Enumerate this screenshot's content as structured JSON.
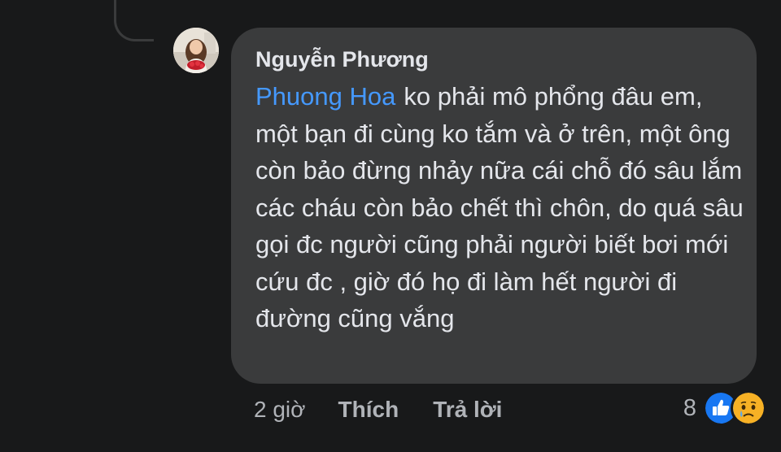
{
  "comment": {
    "author": "Nguyễn Phương",
    "mention": "Phuong Hoa",
    "text": "ko phải mô phổng đâu em, một bạn đi cùng ko tắm và ở trên, một ông còn bảo đừng nhảy nữa cái chỗ đó sâu lắm các cháu còn bảo chết thì chôn, do quá sâu gọi đc người cũng phải người biết bơi mới cứu đc , giờ đó họ đi làm hết người đi đường cũng vắng"
  },
  "actions": {
    "time": "2 giờ",
    "like_label": "Thích",
    "reply_label": "Trả lời"
  },
  "reactions": {
    "count": "8",
    "icons": [
      "like-reaction-icon",
      "sad-reaction-icon"
    ]
  },
  "colors": {
    "background": "#18191a",
    "bubble": "#3a3b3c",
    "text": "#e4e6eb",
    "secondary_text": "#b0b3b8",
    "mention": "#4599ff",
    "like_blue": "#1877f2",
    "sad_yellow": "#f7b125"
  }
}
